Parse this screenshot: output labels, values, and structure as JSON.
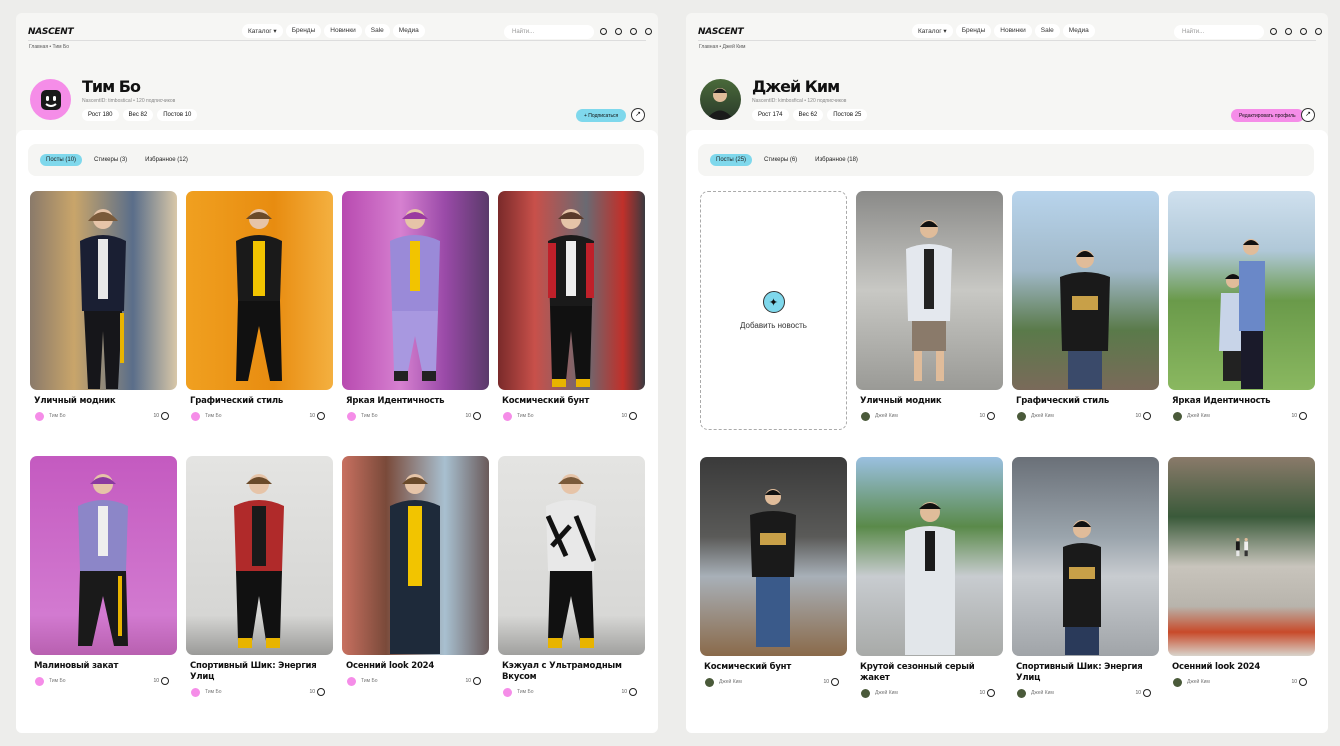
{
  "colors": {
    "accent_blue": "#7fd8ec",
    "accent_pink": "#f58de8",
    "brand_dark": "#111111"
  },
  "profiles": [
    {
      "logo": "NASCENT",
      "nav": [
        "Каталог ▾",
        "Бренды",
        "Новинки",
        "Sale",
        "Медиа"
      ],
      "search_placeholder": "Найти...",
      "breadcrumb": "Главная • Тим Бо",
      "name": "Тим Бо",
      "handle": "NascentID: timbostical • 120 подписчиков",
      "stats": [
        "Рост 180",
        "Вес 82",
        "Постов 10"
      ],
      "main_button": "+ Подписаться",
      "tabs": [
        "Посты (10)",
        "Стикеры (3)",
        "Избранное (12)"
      ],
      "posts": [
        {
          "title": "Уличный модник",
          "author": "Тим Бо",
          "likes": "10"
        },
        {
          "title": "Графический стиль",
          "author": "Тим Бо",
          "likes": "10"
        },
        {
          "title": "Яркая Идентичность",
          "author": "Тим Бо",
          "likes": "10"
        },
        {
          "title": "Космический бунт",
          "author": "Тим Бо",
          "likes": "10"
        },
        {
          "title": "Малиновый закат",
          "author": "Тим Бо",
          "likes": "10"
        },
        {
          "title": "Спортивный Шик: Энергия Улиц",
          "author": "Тим Бо",
          "likes": "10"
        },
        {
          "title": "Осенний look 2024",
          "author": "Тим Бо",
          "likes": "10"
        },
        {
          "title": "Кэжуал с Ультрамодным Вкусом",
          "author": "Тим Бо",
          "likes": "10"
        }
      ]
    },
    {
      "logo": "NASCENT",
      "nav": [
        "Каталог ▾",
        "Бренды",
        "Новинки",
        "Sale",
        "Медиа"
      ],
      "search_placeholder": "Найти...",
      "breadcrumb": "Главная • Джей Ким",
      "name": "Джей Ким",
      "handle": "NascentID: kimbosfical • 120 подписчиков",
      "stats": [
        "Рост 174",
        "Вес 62",
        "Постов 25"
      ],
      "main_button": "Редактировать профиль",
      "tabs": [
        "Посты (25)",
        "Стикеры (6)",
        "Избранное (18)"
      ],
      "add_news": "Добавить новость",
      "posts": [
        {
          "title": "Уличный модник",
          "author": "Джей Ким",
          "likes": "10"
        },
        {
          "title": "Графический стиль",
          "author": "Джей Ким",
          "likes": "10"
        },
        {
          "title": "Яркая Идентичность",
          "author": "Джей Ким",
          "likes": "10"
        },
        {
          "title": "Космический бунт",
          "author": "Джей Ким",
          "likes": "10"
        },
        {
          "title": "Крутой сезонный серый жакет",
          "author": "Джей Ким",
          "likes": "10"
        },
        {
          "title": "Спортивный Шик: Энергия Улиц",
          "author": "Джей Ким",
          "likes": "10"
        },
        {
          "title": "Осенний look 2024",
          "author": "Джей Ким",
          "likes": "10"
        }
      ]
    }
  ]
}
